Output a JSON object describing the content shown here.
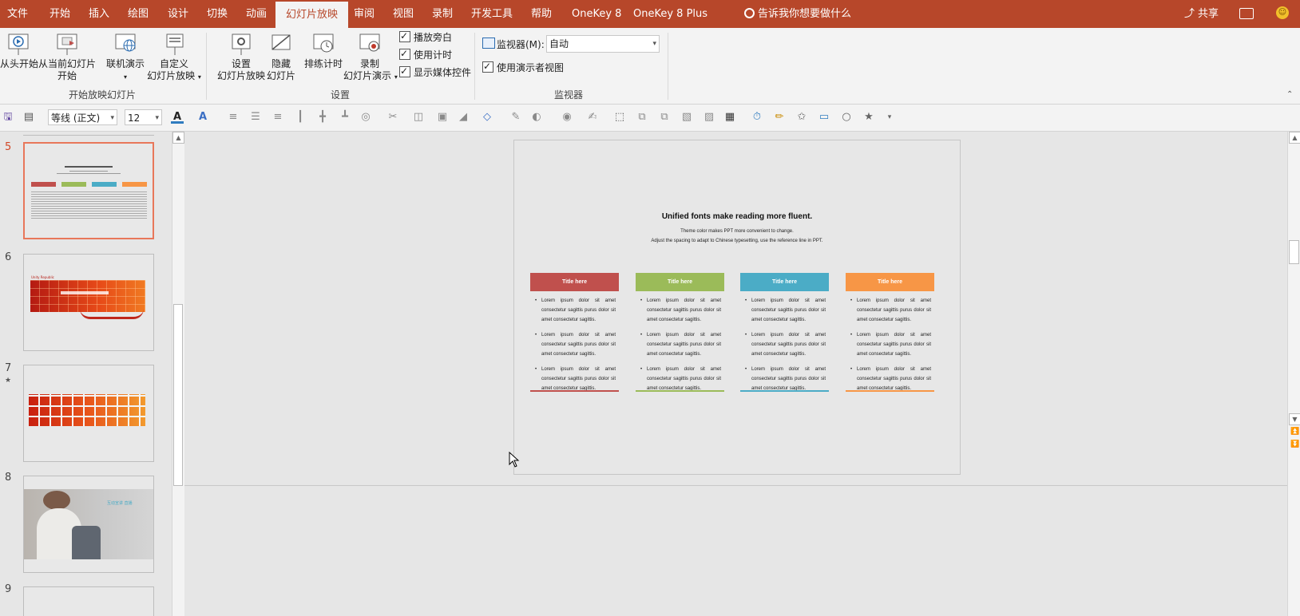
{
  "menu": {
    "tabs": [
      "文件",
      "开始",
      "插入",
      "绘图",
      "设计",
      "切换",
      "动画",
      "幻灯片放映",
      "审阅",
      "视图",
      "录制",
      "开发工具",
      "帮助",
      "OneKey 8",
      "OneKey 8 Plus"
    ],
    "active_tab": "幻灯片放映",
    "search_text": "告诉我你想要做什么",
    "share_label": "共享"
  },
  "ribbon": {
    "start_group": {
      "from_beginning": "从头开始",
      "from_current_1": "从当前幻灯片",
      "from_current_2": "开始",
      "online": "联机演示",
      "custom_1": "自定义",
      "custom_2": "幻灯片放映",
      "label": "开始放映幻灯片"
    },
    "setup_group": {
      "setup_1": "设置",
      "setup_2": "幻灯片放映",
      "hide_1": "隐藏",
      "hide_2": "幻灯片",
      "rehearse": "排练计时",
      "record_1": "录制",
      "record_2": "幻灯片演示",
      "cb_narration": "播放旁白",
      "cb_timings": "使用计时",
      "cb_media": "显示媒体控件",
      "label": "设置"
    },
    "monitor_group": {
      "monitor_label": "监视器(M):",
      "monitor_value": "自动",
      "presenter_view": "使用演示者视图",
      "label": "监视器"
    }
  },
  "format_toolbar": {
    "font_name": "等线 (正文)",
    "font_size": "12"
  },
  "thumbnails": {
    "numbers": [
      "5",
      "6",
      "7",
      "8",
      "9"
    ],
    "active_index": 0,
    "slide6_text": "Unity Republic",
    "slide8_text": "互动宣讲  直播"
  },
  "slide": {
    "title": "Unified fonts make reading more fluent.",
    "subtitle_1": "Theme color makes PPT more convenient to change.",
    "subtitle_2": "Adjust the spacing to adapt to Chinese typesetting, use the reference line in PPT.",
    "columns": [
      {
        "title": "Title here",
        "color": "#c0504d",
        "items": [
          "Lorem ipsum dolor sit amet consectetur sagittis purus dolor sit amet consectetur sagittis.",
          "Lorem ipsum dolor sit amet consectetur sagittis purus dolor sit amet consectetur sagittis.",
          "Lorem ipsum dolor sit amet consectetur sagittis purus dolor sit amet consectetur sagittis."
        ]
      },
      {
        "title": "Title here",
        "color": "#9bbb59",
        "items": [
          "Lorem ipsum dolor sit amet consectetur sagittis purus dolor sit amet consectetur sagittis.",
          "Lorem ipsum dolor sit amet consectetur sagittis purus dolor sit amet consectetur sagittis.",
          "Lorem ipsum dolor sit amet consectetur sagittis purus dolor sit amet consectetur sagittis."
        ]
      },
      {
        "title": "Title here",
        "color": "#4bacc6",
        "items": [
          "Lorem ipsum dolor sit amet consectetur sagittis purus dolor sit amet consectetur sagittis.",
          "Lorem ipsum dolor sit amet consectetur sagittis purus dolor sit amet consectetur sagittis.",
          "Lorem ipsum dolor sit amet consectetur sagittis purus dolor sit amet consectetur sagittis."
        ]
      },
      {
        "title": "Title here",
        "color": "#f79646",
        "items": [
          "Lorem ipsum dolor sit amet consectetur sagittis purus dolor sit amet consectetur sagittis.",
          "Lorem ipsum dolor sit amet consectetur sagittis purus dolor sit amet consectetur sagittis.",
          "Lorem ipsum dolor sit amet consectetur sagittis purus dolor sit amet consectetur sagittis."
        ]
      }
    ]
  },
  "colors": {
    "accent": "#b7472a",
    "active_thumb_border": "#e8775a"
  }
}
